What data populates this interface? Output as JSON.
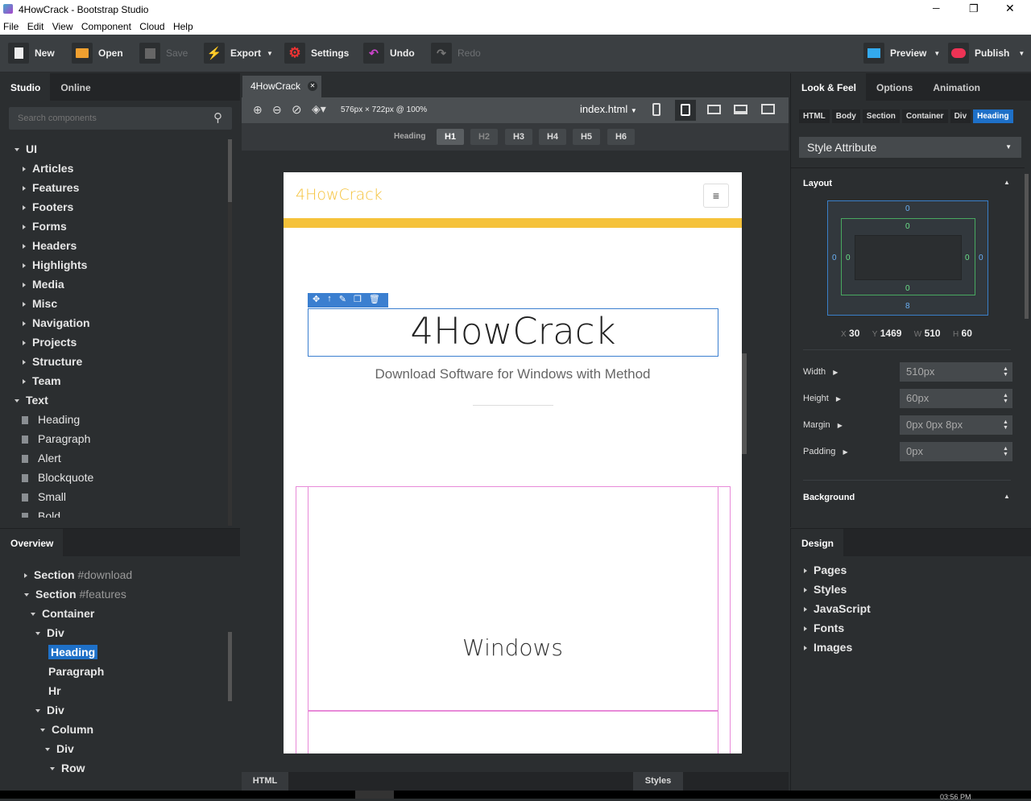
{
  "window": {
    "title": "4HowCrack - Bootstrap Studio",
    "minimize": "─",
    "maximize": "❐",
    "close": "✕"
  },
  "menu": [
    "File",
    "Edit",
    "View",
    "Component",
    "Cloud",
    "Help"
  ],
  "toolbar": {
    "new": "New",
    "open": "Open",
    "save": "Save",
    "export": "Export",
    "settings": "Settings",
    "undo": "Undo",
    "redo": "Redo",
    "preview": "Preview",
    "publish": "Publish"
  },
  "left": {
    "tabs": [
      "Studio",
      "Online"
    ],
    "search_placeholder": "Search components",
    "tree": [
      "UI",
      "Articles",
      "Features",
      "Footers",
      "Forms",
      "Headers",
      "Highlights",
      "Media",
      "Misc",
      "Navigation",
      "Projects",
      "Structure",
      "Team",
      "Text",
      "Heading",
      "Paragraph",
      "Alert",
      "Blockquote",
      "Small",
      "Bold"
    ]
  },
  "overview": {
    "tab": "Overview",
    "items": [
      {
        "label": "Section",
        "id": "#download"
      },
      {
        "label": "Section",
        "id": "#features"
      },
      {
        "label": "Container",
        "id": ""
      },
      {
        "label": "Div",
        "id": ""
      },
      {
        "label": "Heading",
        "id": ""
      },
      {
        "label": "Paragraph",
        "id": ""
      },
      {
        "label": "Hr",
        "id": ""
      },
      {
        "label": "Div",
        "id": ""
      },
      {
        "label": "Column",
        "id": ""
      },
      {
        "label": "Div",
        "id": ""
      },
      {
        "label": "Row",
        "id": ""
      }
    ]
  },
  "editor": {
    "tab": "4HowCrack",
    "size": "576px × 722px @ 100%",
    "file": "index.html",
    "heading_label": "Heading",
    "heading_levels": [
      "H1",
      "H2",
      "H3",
      "H4",
      "H5",
      "H6"
    ],
    "bottom_tabs": [
      "HTML",
      "Styles"
    ]
  },
  "page": {
    "brand": "4HowCrack",
    "heading": "4HowCrack",
    "subtitle": "Download Software for Windows with Method",
    "section_heading": "Windows",
    "accent": "#f5c23a"
  },
  "right": {
    "tabs": [
      "Look & Feel",
      "Options",
      "Animation"
    ],
    "breadcrumb": [
      "HTML",
      "Body",
      "Section",
      "Container",
      "Div",
      "Heading"
    ],
    "style_attr": "Style Attribute",
    "layout_label": "Layout",
    "box": {
      "margin_top": "0",
      "margin_bottom": "8",
      "margin_left": "0",
      "margin_right": "0",
      "padding_top": "0",
      "padding_bottom": "0",
      "padding_left": "0",
      "padding_right": "0"
    },
    "coords": {
      "x_label": "X",
      "x": "30",
      "y_label": "Y",
      "y": "1469",
      "w_label": "W",
      "w": "510",
      "h_label": "H",
      "h": "60"
    },
    "props": [
      {
        "label": "Width",
        "value": "510px"
      },
      {
        "label": "Height",
        "value": "60px"
      },
      {
        "label": "Margin",
        "value": "0px 0px 8px"
      },
      {
        "label": "Padding",
        "value": "0px"
      }
    ],
    "background_label": "Background"
  },
  "design": {
    "tab": "Design",
    "items": [
      "Pages",
      "Styles",
      "JavaScript",
      "Fonts",
      "Images"
    ]
  },
  "taskbar": {
    "time": "03:56 PM"
  }
}
